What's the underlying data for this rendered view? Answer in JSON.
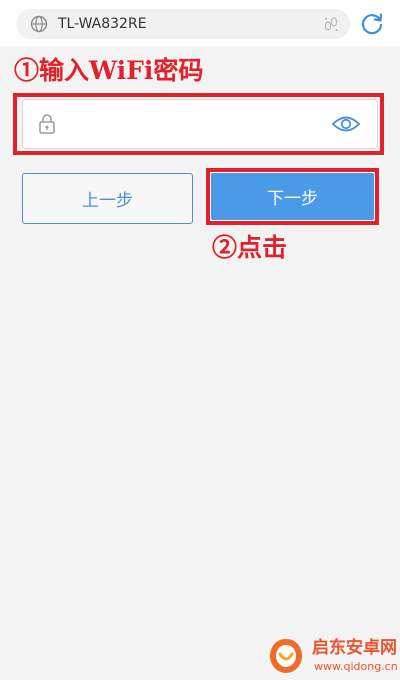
{
  "browser": {
    "url": "TL-WA832RE"
  },
  "annotations": {
    "step1": "①输入WiFi密码",
    "step2": "②点击"
  },
  "password_field": {
    "value": "",
    "placeholder": ""
  },
  "buttons": {
    "prev_label": "上一步",
    "next_label": "下一步"
  },
  "watermark": {
    "name": "启东安卓网",
    "url": "www.qidong.cn"
  },
  "colors": {
    "accent": "#4a9ae8",
    "annotation": "#e0232a",
    "watermark": "#e8542f"
  }
}
